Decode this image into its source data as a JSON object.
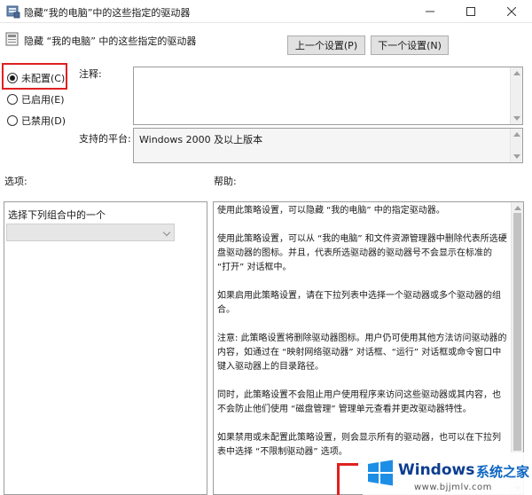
{
  "window": {
    "title": "隐藏“我的电脑”中的这些指定的驱动器"
  },
  "header": {
    "policy_name": "隐藏 “我的电脑” 中的这些指定的驱动器",
    "prev_button": "上一个设置(P)",
    "next_button": "下一个设置(N)"
  },
  "state": {
    "selected": "not_configured",
    "options": [
      {
        "id": "not_configured",
        "label": "未配置(C)"
      },
      {
        "id": "enabled",
        "label": "已启用(E)"
      },
      {
        "id": "disabled",
        "label": "已禁用(D)"
      }
    ]
  },
  "fields": {
    "comment_label": "注释:",
    "comment_value": "",
    "platform_label": "支持的平台:",
    "platform_value": "Windows 2000 及以上版本"
  },
  "options_panel": {
    "title": "选项:",
    "combo_label": "选择下列组合中的一个",
    "combo_value": ""
  },
  "help_panel": {
    "title": "帮助:",
    "paragraphs": [
      "使用此策略设置，可以隐藏 “我的电脑” 中的指定驱动器。",
      "使用此策略设置，可以从 “我的电脑” 和文件资源管理器中删除代表所选硬盘驱动器的图标。并且，代表所选驱动器的驱动器号不会显示在标准的 “打开” 对话框中。",
      "如果启用此策略设置，请在下拉列表中选择一个驱动器或多个驱动器的组合。",
      "注意: 此策略设置将删除驱动器图标。用户仍可使用其他方法访问驱动器的内容，如通过在 “映射网络驱动器” 对话框、“运行” 对话框或命令窗口中键入驱动器上的目录路径。",
      "同时，此策略设置不会阻止用户使用程序来访问这些驱动器或其内容，也不会防止他们使用 “磁盘管理” 管理单元查看并更改驱动器特性。",
      "如果禁用或未配置此策略设置，则会显示所有的驱动器，也可以在下拉列表中选择 “不限制驱动器” 选项。"
    ]
  },
  "watermark": {
    "brand": "Windows",
    "cn": "系统之家",
    "url": "www.bjjmlv.com"
  },
  "colors": {
    "highlight_red": "#e02020",
    "watermark_blue": "#0c3d8f",
    "panel_border": "#9d9d9d"
  }
}
